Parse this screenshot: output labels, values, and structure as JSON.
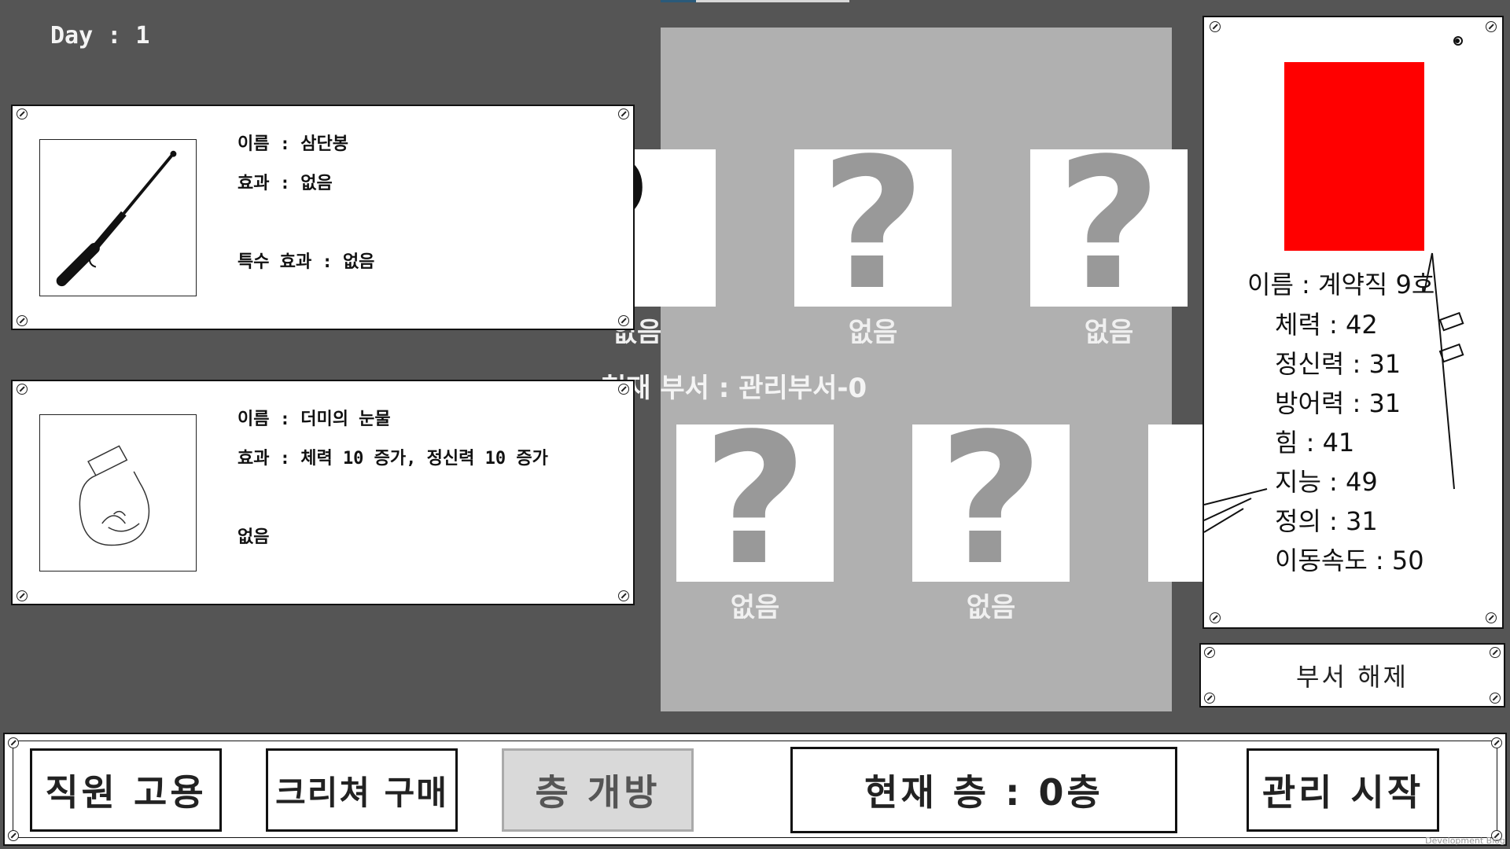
{
  "hud": {
    "day_label": "Day : 1"
  },
  "department": {
    "title": "현재 부서 : 관리부서-0",
    "slot_labels": [
      "없음",
      "없음",
      "없음",
      "없음",
      "없음"
    ]
  },
  "items": [
    {
      "name": "이름 : 삼단봉",
      "effect": "효과 : 없음",
      "special": "특수 효과 : 없음",
      "icon": "baton-icon"
    },
    {
      "name": "이름 : 더미의 눈물",
      "effect": "효과 : 체력 10 증가, 정신력 10 증가",
      "special": "없음",
      "icon": "jar-icon"
    }
  ],
  "employee": {
    "name": "이름 : 계약직 9호",
    "stats": [
      "체력 : 42",
      "정신력 : 31",
      "방어력 : 31",
      "힘 : 41",
      "지능 : 49",
      "정의 : 31",
      "이동속도 : 50"
    ],
    "portrait_color": "#ff0000",
    "unassign_label": "부서 해제"
  },
  "bottom_bar": {
    "hire_label": "직원 고용",
    "buy_creature_label": "크리쳐 구매",
    "open_floor_label": "층 개방",
    "current_floor_label": "현재 층 : 0층",
    "start_label": "관리 시작"
  },
  "watermark": "Development Blog"
}
